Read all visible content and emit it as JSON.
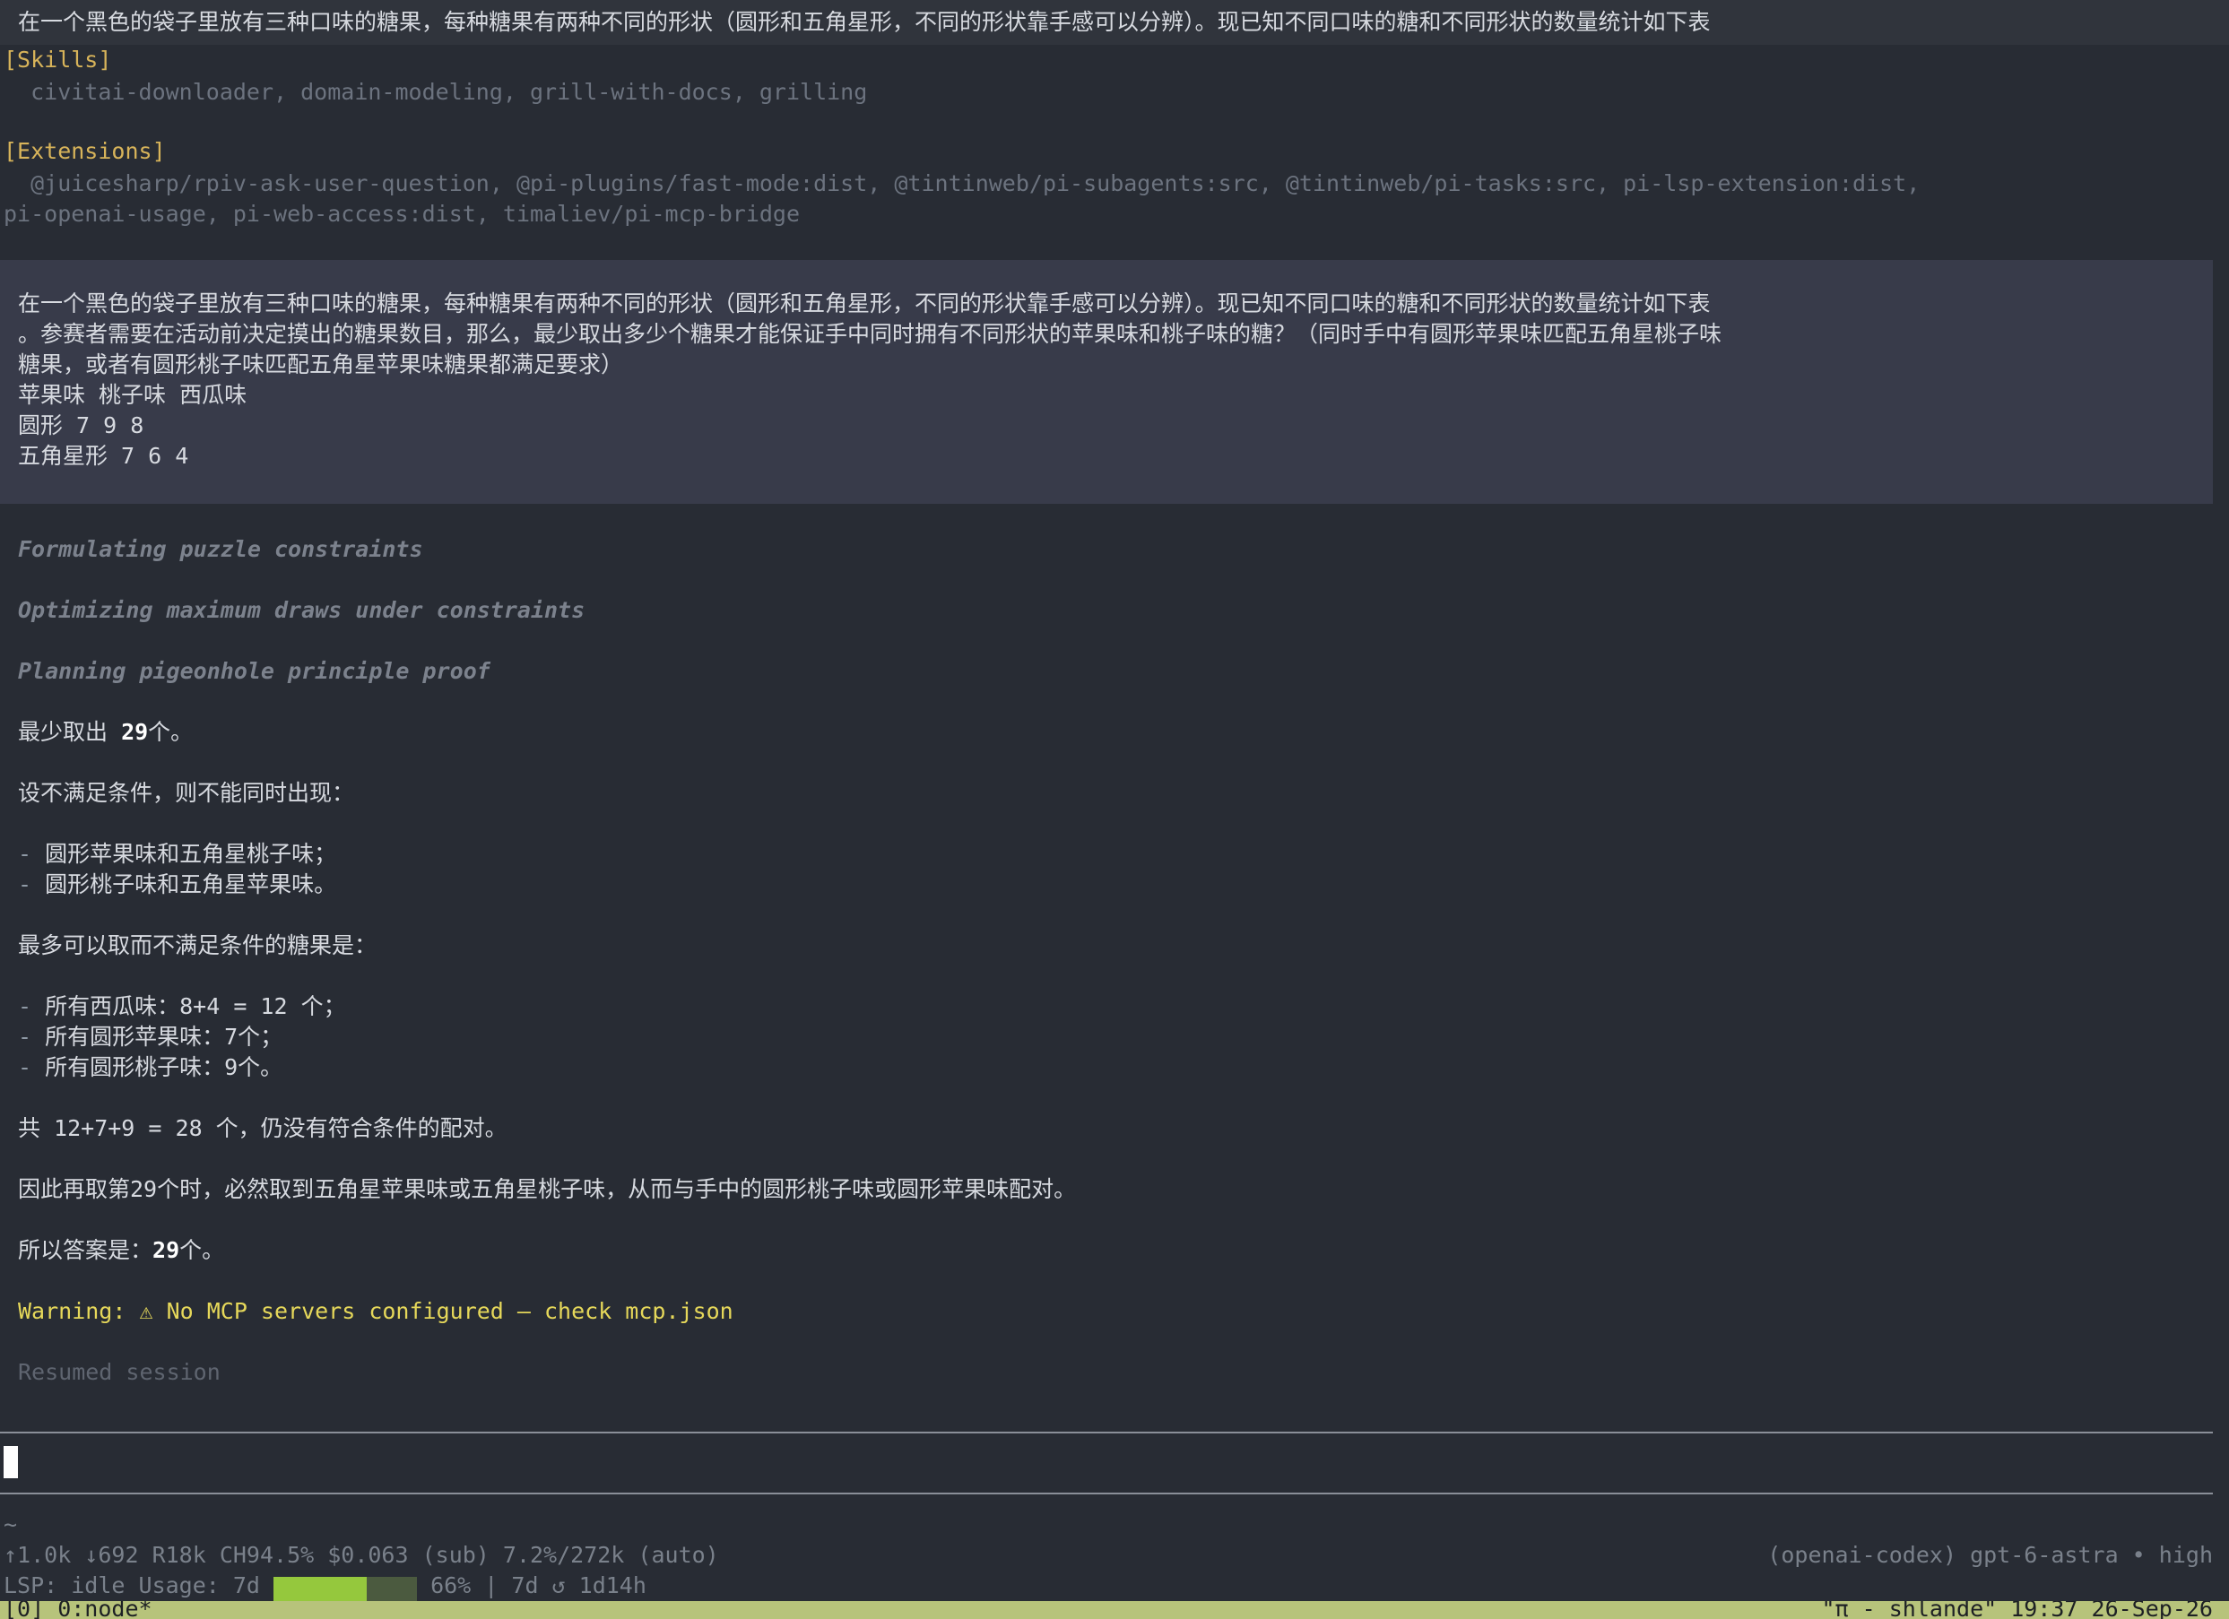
{
  "top_line": "在一个黑色的袋子里放有三种口味的糖果，每种糖果有两种不同的形状（圆形和五角星形，不同的形状靠手感可以分辨）。现已知不同口味的糖和不同形状的数量统计如下表",
  "skills": {
    "heading": "[Skills]",
    "list": "  civitai-downloader, domain-modeling, grill-with-docs, grilling"
  },
  "extensions": {
    "heading": "[Extensions]",
    "list_line1": "  @juicesharp/rpiv-ask-user-question, @pi-plugins/fast-mode:dist, @tintinweb/pi-subagents:src, @tintinweb/pi-tasks:src, pi-lsp-extension:dist,",
    "list_line2": "pi-openai-usage, pi-web-access:dist, timaliev/pi-mcp-bridge"
  },
  "user_message": {
    "line1": "在一个黑色的袋子里放有三种口味的糖果，每种糖果有两种不同的形状（圆形和五角星形，不同的形状靠手感可以分辨）。现已知不同口味的糖和不同形状的数量统计如下表",
    "line2": "。参赛者需要在活动前决定摸出的糖果数目，那么，最少取出多少个糖果才能保证手中同时拥有不同形状的苹果味和桃子味的糖？（同时手中有圆形苹果味匹配五角星桃子味",
    "line3": "糖果，或者有圆形桃子味匹配五角星苹果味糖果都满足要求）",
    "line4": "苹果味 桃子味 西瓜味",
    "line5": "圆形 7 9 8",
    "line6": "五角星形 7 6 4"
  },
  "thinking": [
    "Formulating puzzle constraints",
    "Optimizing maximum draws under constraints",
    "Planning pigeonhole principle proof"
  ],
  "answer": {
    "line1_prefix": "最少取出 ",
    "line1_bold": "29",
    "line1_suffix": "个。",
    "line2": "设不满足条件，则不能同时出现：",
    "bullet1": "圆形苹果味和五角星桃子味；",
    "bullet2": "圆形桃子味和五角星苹果味。",
    "line3": "最多可以取而不满足条件的糖果是：",
    "bullet3": "所有西瓜味：8+4 = 12 个；",
    "bullet4": "所有圆形苹果味：7个；",
    "bullet5": "所有圆形桃子味：9个。",
    "line4": "共 12+7+9 = 28 个，仍没有符合条件的配对。",
    "line5": "因此再取第29个时，必然取到五角星苹果味或五角星桃子味，从而与手中的圆形桃子味或圆形苹果味配对。",
    "line6_prefix": "所以答案是：",
    "line6_bold": "29",
    "line6_suffix": "个。",
    "bullet_marker": "-"
  },
  "warning": "Warning: ⚠ No MCP servers configured — check mcp.json",
  "resumed": "Resumed session",
  "tilde": "~",
  "stats": "↑1.0k ↓692 R18k CH94.5% $0.063 (sub) 7.2%/272k (auto)",
  "model": "(openai-codex) gpt-6-astra • high",
  "lsp_label": "LSP: idle Usage: 7d ",
  "usage_fraction": 0.66,
  "usage_suffix": " 66% | 7d ↺ 1d14h",
  "tmux_left": "[0] 0:node*",
  "tmux_right": "\"π - shlande\" 19:37 26-Sep-26",
  "colors": {
    "background": "#282c34",
    "user_block": "#383b4a",
    "heading": "#d8b45a",
    "warning": "#e6d85a",
    "usage_bar": "#95c83d",
    "status_bar": "#b7c37b"
  }
}
